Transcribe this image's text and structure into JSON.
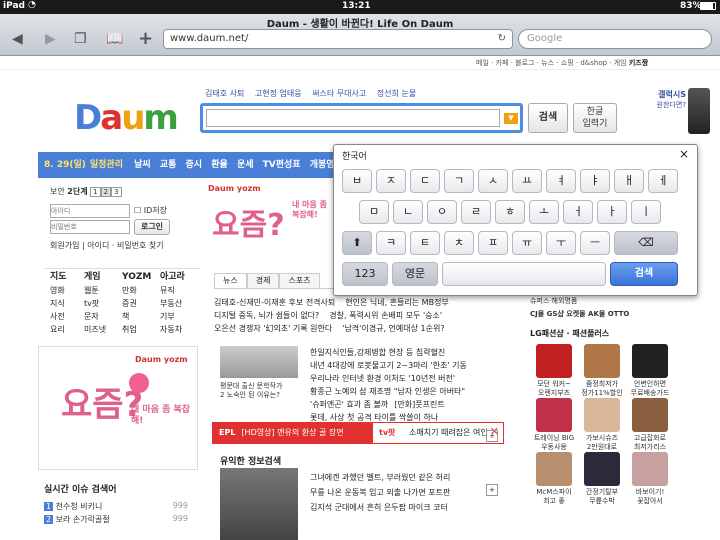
{
  "status_bar": {
    "device": "iPad",
    "time": "13:21",
    "battery": "83%"
  },
  "browser": {
    "title": "Daum - 생활이 바뀐다! Life On Daum",
    "url": "www.daum.net/",
    "search_placeholder": "Google"
  },
  "util_links": [
    "메일",
    "카페",
    "블로그",
    "뉴스",
    "쇼핑",
    "d&shop",
    "게임",
    "키즈짱"
  ],
  "logo": "Daum",
  "hot_keywords": [
    "김태호 사퇴",
    "고현정 엄태웅",
    "써스타 무대사고",
    "정선희 눈물"
  ],
  "search": {
    "button": "검색",
    "hangul_button_line1": "한글",
    "hangul_button_line2": "입력기"
  },
  "galaxy_ad": {
    "line1": "갤럭시S",
    "line2": "원한다면?"
  },
  "navbar": {
    "date": "8. 29",
    "weekday": "(일)",
    "label": "일정관리",
    "items": [
      "날씨",
      "교통",
      "증시",
      "환율",
      "운세",
      "TV편성표",
      "개봉영화"
    ]
  },
  "login": {
    "security": "보안",
    "level": "2단계",
    "levels": [
      "1",
      "2",
      "3"
    ],
    "id_placeholder": "아이디",
    "password_placeholder": "비밀번호",
    "id_save": "ID저장",
    "login_button": "로그인",
    "links": [
      "회원가입",
      "아이디",
      "비밀번호 찾기"
    ]
  },
  "menu_columns": [
    [
      "지도",
      "영화",
      "지식",
      "사전",
      "요리"
    ],
    [
      "게임",
      "웹툰",
      "tv팟",
      "문자",
      "미즈넷"
    ],
    [
      "YOZM",
      "만화",
      "증권",
      "책",
      "취업"
    ],
    [
      "아고라",
      "뮤직",
      "부동산",
      "기부",
      "자동차"
    ]
  ],
  "yozm_ad": {
    "brand": "Daum yozm",
    "big": "요즘?",
    "small": "내 마음 좀 복잡해!"
  },
  "realtime": {
    "title": "실시간 이슈 검색어",
    "items": [
      {
        "rank": "1",
        "text": "천수청 비키니",
        "count": "999"
      },
      {
        "rank": "2",
        "text": "보라 손가락골절",
        "count": "999"
      }
    ]
  },
  "news_tabs": [
    "뉴스",
    "경제",
    "스포츠"
  ],
  "news_top": [
    "김태호-신재민-이재훈 후보 전격사퇴",
    "현인은 닉네, 흔들리는 MB정부",
    "디지털 중독, 뇌가 쉼들이 없다?",
    "경찰, 폭력시위 손배피 모두 '승소'",
    "오은선 경쟁자 '幻의초' 기록 원한다",
    "'남격'이경규, 언예대상 1순위?"
  ],
  "news_photo_caption": [
    "평문대 출신 문학작가",
    "2 노숙인 된 이유는?"
  ],
  "news_list": [
    "한일지식인들,강제병합 현장 등 침략혈진",
    "내년 4대강에 로봇물고기 2~3마리 '한조' 기동",
    "우리나라 인터넷 환경 이처도 '10년전 버전'",
    "황종근 노예의 삼 재조명 \"남자 인생은 아버타\"",
    "'슈퍼엔곤' 효과 좀 볼까",
    "[만화]풋프린트",
    "롯데, 사상 첫 공격 타이틀 싹쓸이 하나"
  ],
  "banner": {
    "tag": "EPL",
    "text": "[HD영상] 맨유의 환상 골 장면",
    "tv": "tv팟",
    "right": "소매치기 때려잡은 여인"
  },
  "useful": {
    "title": "유익한 정보검색",
    "items": [
      "그녀에겐 과했던 벨트, 부러웠던 같은 허리",
      "무릎 나온 운동복 입고 외출 나가면 포트판",
      "김지석 군대에서 흔히 은두팝 마이크 코터"
    ]
  },
  "shopping": {
    "top": "슈퍼스·해외명품",
    "ad_line": "CJ몰 GS샵 요켓몰 AK몰 OTTO",
    "title": "LG패션샵 · 패션플러스",
    "items": [
      [
        "모던 워커~",
        "오렌지부츠"
      ],
      [
        "줌정최저가",
        "정가11%할인"
      ],
      [
        "언변인하면",
        "무료배송가드"
      ],
      [
        "트레이닝 BIG",
        "우동사용"
      ],
      [
        "가보시슈즈",
        "2만원대로"
      ],
      [
        "고급잡화로",
        "최저가리스"
      ],
      [
        "McM스파이",
        "최고 좋"
      ],
      [
        "간정기탈부",
        "무릎수박"
      ],
      [
        "바보이기!",
        "꽃잡아서"
      ]
    ]
  },
  "keyboard": {
    "title": "한국어",
    "close": "×",
    "row1": [
      "ㅂ",
      "ㅈ",
      "ㄷ",
      "ㄱ",
      "ㅅ",
      "ㅛ",
      "ㅕ",
      "ㅑ",
      "ㅐ",
      "ㅔ"
    ],
    "row2": [
      "ㅁ",
      "ㄴ",
      "ㅇ",
      "ㄹ",
      "ㅎ",
      "ㅗ",
      "ㅓ",
      "ㅏ",
      "ㅣ"
    ],
    "row3": [
      "ㅋ",
      "ㅌ",
      "ㅊ",
      "ㅍ",
      "ㅠ",
      "ㅜ",
      "ㅡ"
    ],
    "numbers": "123",
    "lang": "영문",
    "enter": "검색"
  },
  "colors": {
    "accent": "#4a7fd8",
    "brand_red": "#e03030",
    "pink": "#e0608c"
  }
}
